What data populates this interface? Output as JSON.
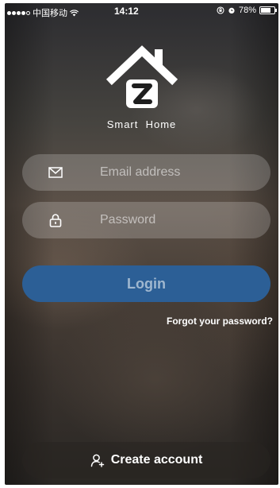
{
  "status_bar": {
    "carrier": "中国移动",
    "time": "14:12",
    "battery_percent": "78%",
    "battery_level": 0.78
  },
  "app": {
    "name": "Smart  Home",
    "logo_letter": "Z"
  },
  "form": {
    "email": {
      "placeholder": "Email address",
      "value": "",
      "icon": "envelope-icon"
    },
    "password": {
      "placeholder": "Password",
      "value": "",
      "icon": "lock-icon"
    },
    "login_label": "Login",
    "forgot_label": "Forgot your password?"
  },
  "footer": {
    "create_account_label": "Create account",
    "icon": "add-user-icon"
  },
  "colors": {
    "login_button": "#2c5f96",
    "text": "#ffffff"
  }
}
